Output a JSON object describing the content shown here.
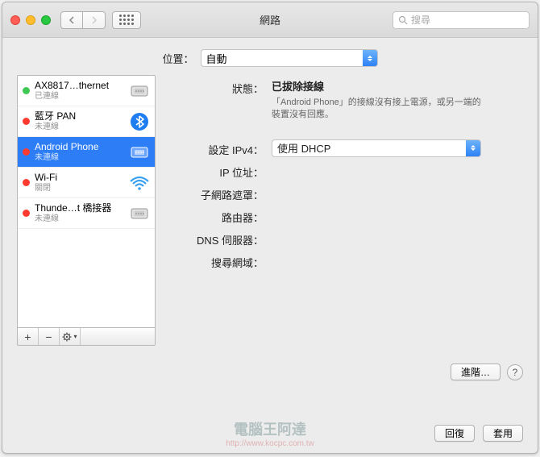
{
  "window": {
    "title": "網路"
  },
  "search": {
    "placeholder": "搜尋"
  },
  "location": {
    "label": "位置：",
    "value": "自動"
  },
  "sidebar": {
    "items": [
      {
        "name": "AX8817…thernet",
        "status": "已連線",
        "dot": "g",
        "icon": "ethernet"
      },
      {
        "name": "藍牙 PAN",
        "status": "未連線",
        "dot": "r",
        "icon": "bluetooth"
      },
      {
        "name": "Android Phone",
        "status": "未連線",
        "dot": "r",
        "icon": "ethernet-sel",
        "selected": true
      },
      {
        "name": "Wi-Fi",
        "status": "關閉",
        "dot": "r",
        "icon": "wifi"
      },
      {
        "name": "Thunde…t 橋接器",
        "status": "未連線",
        "dot": "r",
        "icon": "ethernet"
      }
    ]
  },
  "details": {
    "status_label": "狀態：",
    "status_value": "已拔除接線",
    "status_desc": "「Android Phone」的接線沒有接上電源，或另一端的裝置沒有回應。",
    "ipv4_label": "設定 IPv4：",
    "ipv4_value": "使用 DHCP",
    "ip_label": "IP 位址：",
    "subnet_label": "子網路遮罩：",
    "router_label": "路由器：",
    "dns_label": "DNS 伺服器：",
    "search_domain_label": "搜尋網域："
  },
  "buttons": {
    "advanced": "進階…",
    "revert": "回復",
    "apply": "套用"
  },
  "watermark": {
    "line1": "電腦王阿達",
    "line2": "http://www.kocpc.com.tw"
  }
}
